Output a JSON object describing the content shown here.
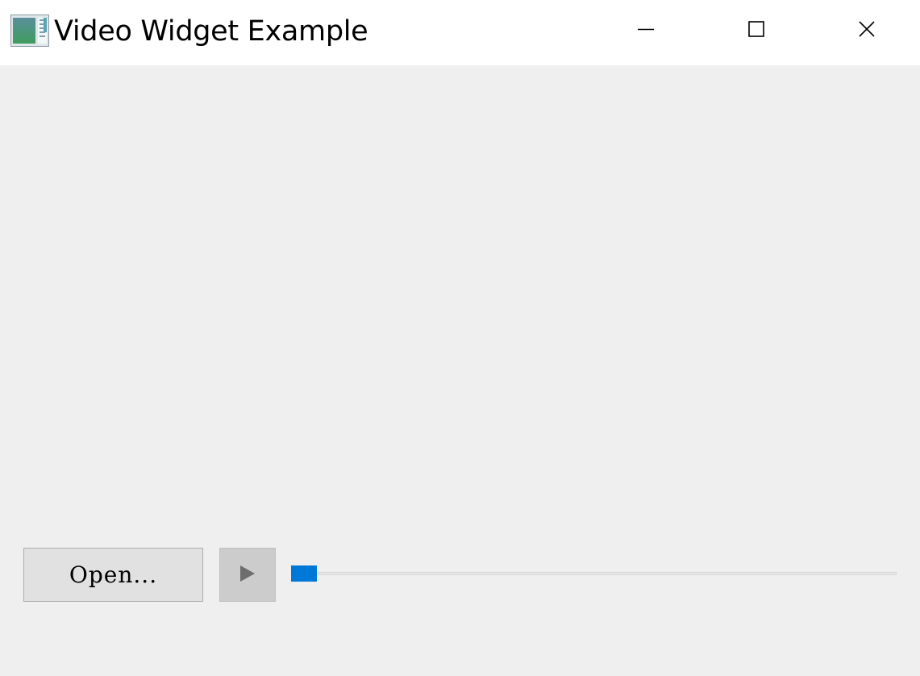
{
  "window": {
    "title": "Video Widget Example",
    "icons": {
      "app": "app-window-icon",
      "minimize": "minimize-icon",
      "maximize": "maximize-icon",
      "close": "close-icon"
    }
  },
  "controls": {
    "open_label": "Open...",
    "play_icon": "play-icon",
    "position": 0,
    "accent_color": "#0078d7"
  }
}
